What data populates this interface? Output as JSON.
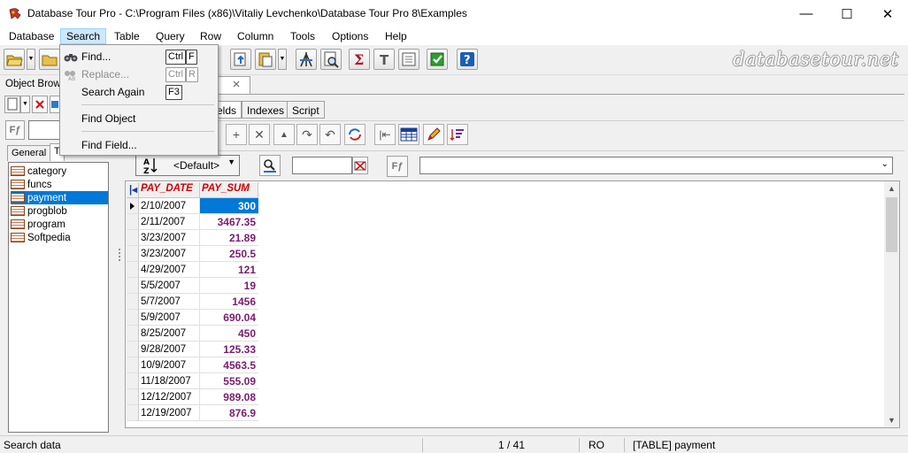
{
  "window": {
    "title": "Database Tour Pro - C:\\Program Files (x86)\\Vitaliy Levchenko\\Database Tour Pro 8\\Examples",
    "minimize": "—",
    "maximize": "☐",
    "close": "✕"
  },
  "menubar": [
    "Database",
    "Search",
    "Table",
    "Query",
    "Row",
    "Column",
    "Tools",
    "Options",
    "Help"
  ],
  "search_menu": {
    "find": {
      "label": "Find...",
      "keys": [
        "Ctrl",
        "F"
      ]
    },
    "replace": {
      "label": "Replace...",
      "keys": [
        "Ctrl",
        "R"
      ]
    },
    "search_again": {
      "label": "Search Again",
      "keys": [
        "F3"
      ]
    },
    "find_object": {
      "label": "Find Object"
    },
    "find_field": {
      "label": "Find Field..."
    }
  },
  "brand": "databasetour.net",
  "left_panel": {
    "title": "Object Brows",
    "tabs": [
      "General",
      "T"
    ],
    "filter_icon": "Fƒ",
    "tables": [
      "category",
      "funcs",
      "payment",
      "progblob",
      "program",
      "Softpedia"
    ],
    "selected": "payment"
  },
  "doc_tab": "nt",
  "sub_tabs": [
    "elds",
    "Indexes",
    "Script"
  ],
  "sort_combo": "<Default>",
  "grid": {
    "columns": [
      "PAY_DATE",
      "PAY_SUM"
    ],
    "rows": [
      [
        "2/10/2007",
        "300"
      ],
      [
        "2/11/2007",
        "3467.35"
      ],
      [
        "3/23/2007",
        "21.89"
      ],
      [
        "3/23/2007",
        "250.5"
      ],
      [
        "4/29/2007",
        "121"
      ],
      [
        "5/5/2007",
        "19"
      ],
      [
        "5/7/2007",
        "1456"
      ],
      [
        "5/9/2007",
        "690.04"
      ],
      [
        "8/25/2007",
        "450"
      ],
      [
        "9/28/2007",
        "125.33"
      ],
      [
        "10/9/2007",
        "4563.5"
      ],
      [
        "11/18/2007",
        "555.09"
      ],
      [
        "12/12/2007",
        "989.08"
      ],
      [
        "12/19/2007",
        "876.9"
      ]
    ],
    "current_row": 0
  },
  "status": {
    "message": "Search data",
    "record": "1 / 41",
    "mode": "RO",
    "object": "[TABLE] payment"
  },
  "colors": {
    "accent": "#0078d7",
    "column_header": "#d00000",
    "sum_value": "#7a1c6e"
  }
}
